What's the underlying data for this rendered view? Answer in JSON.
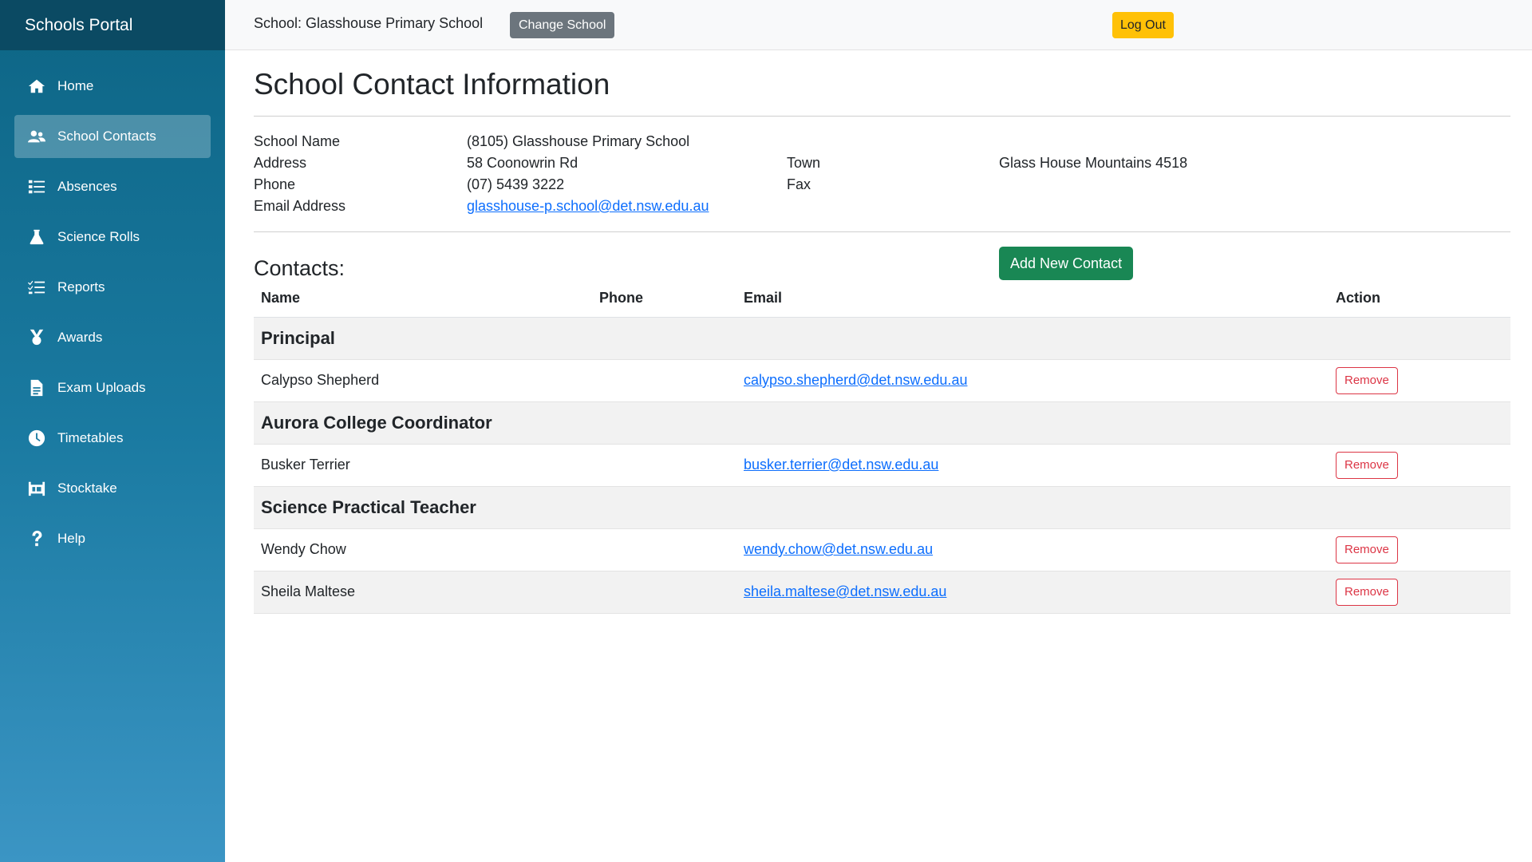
{
  "sidebar": {
    "brand": "Schools Portal",
    "items": [
      {
        "label": "Home",
        "icon": "home-icon",
        "active": false
      },
      {
        "label": "School Contacts",
        "icon": "users-icon",
        "active": true
      },
      {
        "label": "Absences",
        "icon": "list-icon",
        "active": false
      },
      {
        "label": "Science Rolls",
        "icon": "flask-icon",
        "active": false
      },
      {
        "label": "Reports",
        "icon": "checklist-icon",
        "active": false
      },
      {
        "label": "Awards",
        "icon": "medal-icon",
        "active": false
      },
      {
        "label": "Exam Uploads",
        "icon": "file-icon",
        "active": false
      },
      {
        "label": "Timetables",
        "icon": "clock-icon",
        "active": false
      },
      {
        "label": "Stocktake",
        "icon": "warehouse-icon",
        "active": false
      },
      {
        "label": "Help",
        "icon": "question-icon",
        "active": false
      }
    ]
  },
  "topbar": {
    "school_label": "School: Glasshouse Primary School",
    "change_school": "Change School",
    "logout": "Log Out"
  },
  "page": {
    "title": "School Contact Information"
  },
  "school_info": {
    "name_label": "School Name",
    "name_value": "(8105) Glasshouse Primary School",
    "address_label": "Address",
    "address_value": "58 Coonowrin Rd",
    "town_label": "Town",
    "town_value": "Glass House Mountains 4518",
    "phone_label": "Phone",
    "phone_value": "(07) 5439 3222",
    "fax_label": "Fax",
    "fax_value": "",
    "email_label": "Email Address",
    "email_value": "glasshouse-p.school@det.nsw.edu.au"
  },
  "contacts": {
    "title": "Contacts:",
    "add_button": "Add New Contact",
    "columns": {
      "name": "Name",
      "phone": "Phone",
      "email": "Email",
      "action": "Action"
    },
    "remove_label": "Remove",
    "groups": [
      {
        "role": "Principal",
        "people": [
          {
            "name": "Calypso Shepherd",
            "phone": "",
            "email": "calypso.shepherd@det.nsw.edu.au"
          }
        ]
      },
      {
        "role": "Aurora College Coordinator",
        "people": [
          {
            "name": "Busker Terrier",
            "phone": "",
            "email": "busker.terrier@det.nsw.edu.au"
          }
        ]
      },
      {
        "role": "Science Practical Teacher",
        "people": [
          {
            "name": "Wendy Chow",
            "phone": "",
            "email": "wendy.chow@det.nsw.edu.au"
          },
          {
            "name": "Sheila Maltese",
            "phone": "",
            "email": "sheila.maltese@det.nsw.edu.au"
          }
        ]
      }
    ]
  },
  "colors": {
    "sidebar_top": "#0d6585",
    "sidebar_bottom": "#3b95c4",
    "brand_bg": "#0b4a63",
    "add_button": "#198754",
    "logout_button": "#ffc107",
    "change_button": "#6c757d",
    "remove_button": "#dc3545"
  }
}
